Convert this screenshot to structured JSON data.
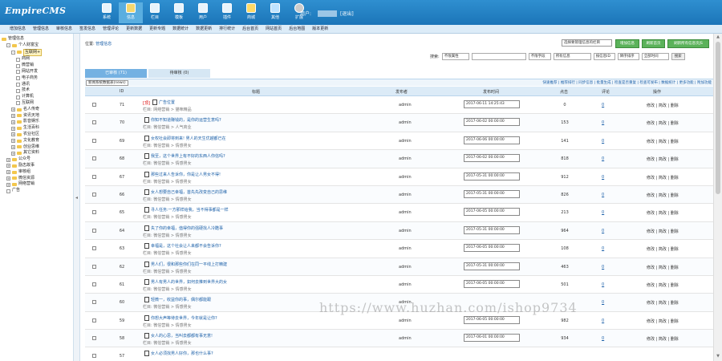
{
  "app": {
    "logo": "EmpireCMS"
  },
  "topnav": [
    {
      "label": "系统",
      "icon": "system-icon"
    },
    {
      "label": "信息",
      "icon": "info-icon"
    },
    {
      "label": "栏目",
      "icon": "folder-icon"
    },
    {
      "label": "模板",
      "icon": "template-icon"
    },
    {
      "label": "用户",
      "icon": "user-icon"
    },
    {
      "label": "插件",
      "icon": "plugin-icon"
    },
    {
      "label": "商城",
      "icon": "shop-icon"
    },
    {
      "label": "其他",
      "icon": "other-icon"
    },
    {
      "label": "扩展",
      "icon": "extend-icon"
    }
  ],
  "user": {
    "label": "用户:",
    "logout": "[退出]"
  },
  "subnav": [
    "增加信息",
    "管理信息",
    "审核信息",
    "签发信息",
    "管理评论",
    "更新数据",
    "更新专题",
    "数据统计",
    "数据更新",
    "排行统计",
    "后台首页",
    "网站首页",
    "后台地图",
    "版本更新"
  ],
  "sidebar": {
    "items": [
      {
        "label": "管理信息",
        "indent": 0,
        "type": "root"
      },
      {
        "label": "个人财富宝",
        "indent": 1,
        "type": "folder",
        "toggle": "-"
      },
      {
        "label": "互联网+",
        "indent": 2,
        "type": "folder",
        "toggle": "-",
        "highlight": true
      },
      {
        "label": "商网",
        "indent": 3,
        "type": "leaf"
      },
      {
        "label": "微营销",
        "indent": 3,
        "type": "leaf"
      },
      {
        "label": "网站开发",
        "indent": 3,
        "type": "leaf"
      },
      {
        "label": "电子商务",
        "indent": 3,
        "type": "leaf"
      },
      {
        "label": "通讯",
        "indent": 3,
        "type": "leaf"
      },
      {
        "label": "技术",
        "indent": 3,
        "type": "leaf"
      },
      {
        "label": "计算机",
        "indent": 3,
        "type": "leaf"
      },
      {
        "label": "互联网",
        "indent": 3,
        "type": "leaf"
      },
      {
        "label": "名人传奇",
        "indent": 2,
        "type": "folder",
        "toggle": "+"
      },
      {
        "label": "资讯天地",
        "indent": 2,
        "type": "folder",
        "toggle": "+"
      },
      {
        "label": "影音娱乐",
        "indent": 2,
        "type": "folder",
        "toggle": "+"
      },
      {
        "label": "生活百科",
        "indent": 2,
        "type": "folder",
        "toggle": "+"
      },
      {
        "label": "农业社区",
        "indent": 2,
        "type": "folder",
        "toggle": "+"
      },
      {
        "label": "文化教育",
        "indent": 2,
        "type": "folder",
        "toggle": "+"
      },
      {
        "label": "创业思维",
        "indent": 2,
        "type": "folder",
        "toggle": "+"
      },
      {
        "label": "其它资料",
        "indent": 2,
        "type": "folder",
        "toggle": "+"
      },
      {
        "label": "公众号",
        "indent": 1,
        "type": "folder",
        "toggle": "+"
      },
      {
        "label": "励志故事",
        "indent": 1,
        "type": "folder",
        "toggle": "+"
      },
      {
        "label": "审核组",
        "indent": 1,
        "type": "folder",
        "toggle": "+"
      },
      {
        "label": "微信资源",
        "indent": 1,
        "type": "folder",
        "toggle": "+"
      },
      {
        "label": "网络营销",
        "indent": 1,
        "type": "folder",
        "toggle": "+"
      },
      {
        "label": "广告",
        "indent": 1,
        "type": "leaf"
      }
    ]
  },
  "location": {
    "label": "位置:",
    "link": "管理信息"
  },
  "category_select": "选择要管理信息的栏目",
  "actions": {
    "add": "增加信息",
    "refresh": "刷新首页",
    "refresh_all": "刷新所有信息页JS"
  },
  "search": {
    "label": "搜索:",
    "type_select": "不限属性",
    "input": "",
    "field_select": "不限字段",
    "flag_select": "所有信息",
    "order_select": "按信息ID",
    "direction_select": "降序排序",
    "time_select": "全部时间",
    "button": "搜索"
  },
  "tabs": [
    {
      "label": "已审核 (71)",
      "active": true
    },
    {
      "label": "待审核 (0)",
      "active": false
    }
  ],
  "table_bar": {
    "table_select": "新闻系统数据表(news)",
    "actions": "快速推荐 | 推荐排行 | 同步信息 | 批量生成 | 检查是否重复 | 检查可发布 | 数据统计 | 更多功能 | 附加功能"
  },
  "columns": {
    "id": "ID",
    "title": "标题",
    "publisher": "发布者",
    "time": "发布时间",
    "hits": "点击",
    "comments": "评论",
    "ops": "操作"
  },
  "rows": [
    {
      "id": "71",
      "top": "[顶]",
      "title": "广告位置",
      "column": "栏目: 网络营销 > 猫咪精品",
      "publisher": "admin",
      "time": "2017-06-11 14:25:43",
      "hits": "0",
      "comments": "0",
      "ops": "修改 | 简改 | 删除"
    },
    {
      "id": "70",
      "top": "",
      "title": "你知不知道赚钱的，是你的运营生意吗?",
      "column": "栏目: 微信营销 > 人气商业",
      "publisher": "admin",
      "time": "2017-06-02 00:00:00",
      "hits": "153",
      "comments": "0",
      "ops": "修改 | 简改 | 删除"
    },
    {
      "id": "69",
      "top": "",
      "title": "女权社会即将到来!  男人的天生优越都已在",
      "column": "栏目: 微信营销 > 情感男女",
      "publisher": "admin",
      "time": "2017-06-06 00:00:00",
      "hits": "141",
      "comments": "0",
      "ops": "修改 | 简改 | 删除"
    },
    {
      "id": "68",
      "top": "",
      "title": "我至，这个世界上有不好的东西人你信吗?",
      "column": "栏目: 微信营销 > 情感男女",
      "publisher": "admin",
      "time": "2017-06-02 00:00:00",
      "hits": "818",
      "comments": "0",
      "ops": "修改 | 简改 | 删除"
    },
    {
      "id": "67",
      "top": "",
      "title": "那些过来人告诉你，你是让人男女不得!",
      "column": "栏目: 微信营销 > 情感男女",
      "publisher": "admin",
      "time": "2017-05-31 00:00:00",
      "hits": "912",
      "comments": "0",
      "ops": "修改 | 简改 | 删除"
    },
    {
      "id": "66",
      "top": "",
      "title": "女人想要自己幸福，首先先改变自己的思维",
      "column": "栏目: 微信营销 > 情感男女",
      "publisher": "admin",
      "time": "2017-05-31 00:00:00",
      "hits": "826",
      "comments": "0",
      "ops": "修改 | 简改 | 删除"
    },
    {
      "id": "65",
      "top": "",
      "title": "寻人任务:一方那样给我，当不得事都是一样",
      "column": "栏目: 微信营销 > 情感男女",
      "publisher": "admin",
      "time": "2017-06-05 00:00:00",
      "hits": "213",
      "comments": "0",
      "ops": "修改 | 简改 | 删除"
    },
    {
      "id": "64",
      "top": "",
      "title": "失了你的幸福，值得你的强硬找人冷酷事",
      "column": "栏目: 微信营销 > 情感男女",
      "publisher": "admin",
      "time": "2017-05-31 00:00:00",
      "hits": "964",
      "comments": "0",
      "ops": "修改 | 简改 | 删除"
    },
    {
      "id": "63",
      "top": "",
      "title": "幸福是，这个社会让人来都不会告诉你?",
      "column": "栏目: 微信营销 > 情感男女",
      "publisher": "admin",
      "time": "2017-06-05 00:00:00",
      "hits": "108",
      "comments": "0",
      "ops": "修改 | 简改 | 删除"
    },
    {
      "id": "62",
      "top": "",
      "title": "男人们，很和那些你们在同一平线上打精建",
      "column": "栏目: 微信营销 > 情感男女",
      "publisher": "admin",
      "time": "2017-05-31 00:00:00",
      "hits": "463",
      "comments": "0",
      "ops": "修改 | 简改 | 删除"
    },
    {
      "id": "61",
      "top": "",
      "title": "男人有男人的世界，如何去推到世界大的女",
      "column": "栏目: 微信营销 > 情感男女",
      "publisher": "admin",
      "time": "2017-06-05 00:00:00",
      "hits": "501",
      "comments": "0",
      "ops": "修改 | 简改 | 删除"
    },
    {
      "id": "60",
      "top": "",
      "title": "轻微一，收益你的事，偶尔都能跟",
      "column": "栏目: 微信营销 > 情感男女",
      "publisher": "admin",
      "time": "",
      "hits": "",
      "comments": "0",
      "ops": "修改 | 简改 | 删除"
    },
    {
      "id": "59",
      "top": "",
      "title": "你想大声等待去世界，今年就是让你?",
      "column": "栏目: 微信营销 > 情感男女",
      "publisher": "admin",
      "time": "2017-06-05 00:00:00",
      "hits": "982",
      "comments": "0",
      "ops": "修改 | 简改 | 删除"
    },
    {
      "id": "58",
      "top": "",
      "title": "女人的心思，当叫去都都有事无意!",
      "column": "栏目: 微信营销 > 情感男女",
      "publisher": "admin",
      "time": "2017-06-01 00:00:00",
      "hits": "934",
      "comments": "0",
      "ops": "修改 | 简改 | 删除"
    },
    {
      "id": "57",
      "top": "",
      "title": "女人必须找男人好你，那也什么事?",
      "column": "",
      "publisher": "",
      "time": "",
      "hits": "",
      "comments": "",
      "ops": ""
    }
  ],
  "watermark": "https://www.huzhan.com/ishop9734"
}
